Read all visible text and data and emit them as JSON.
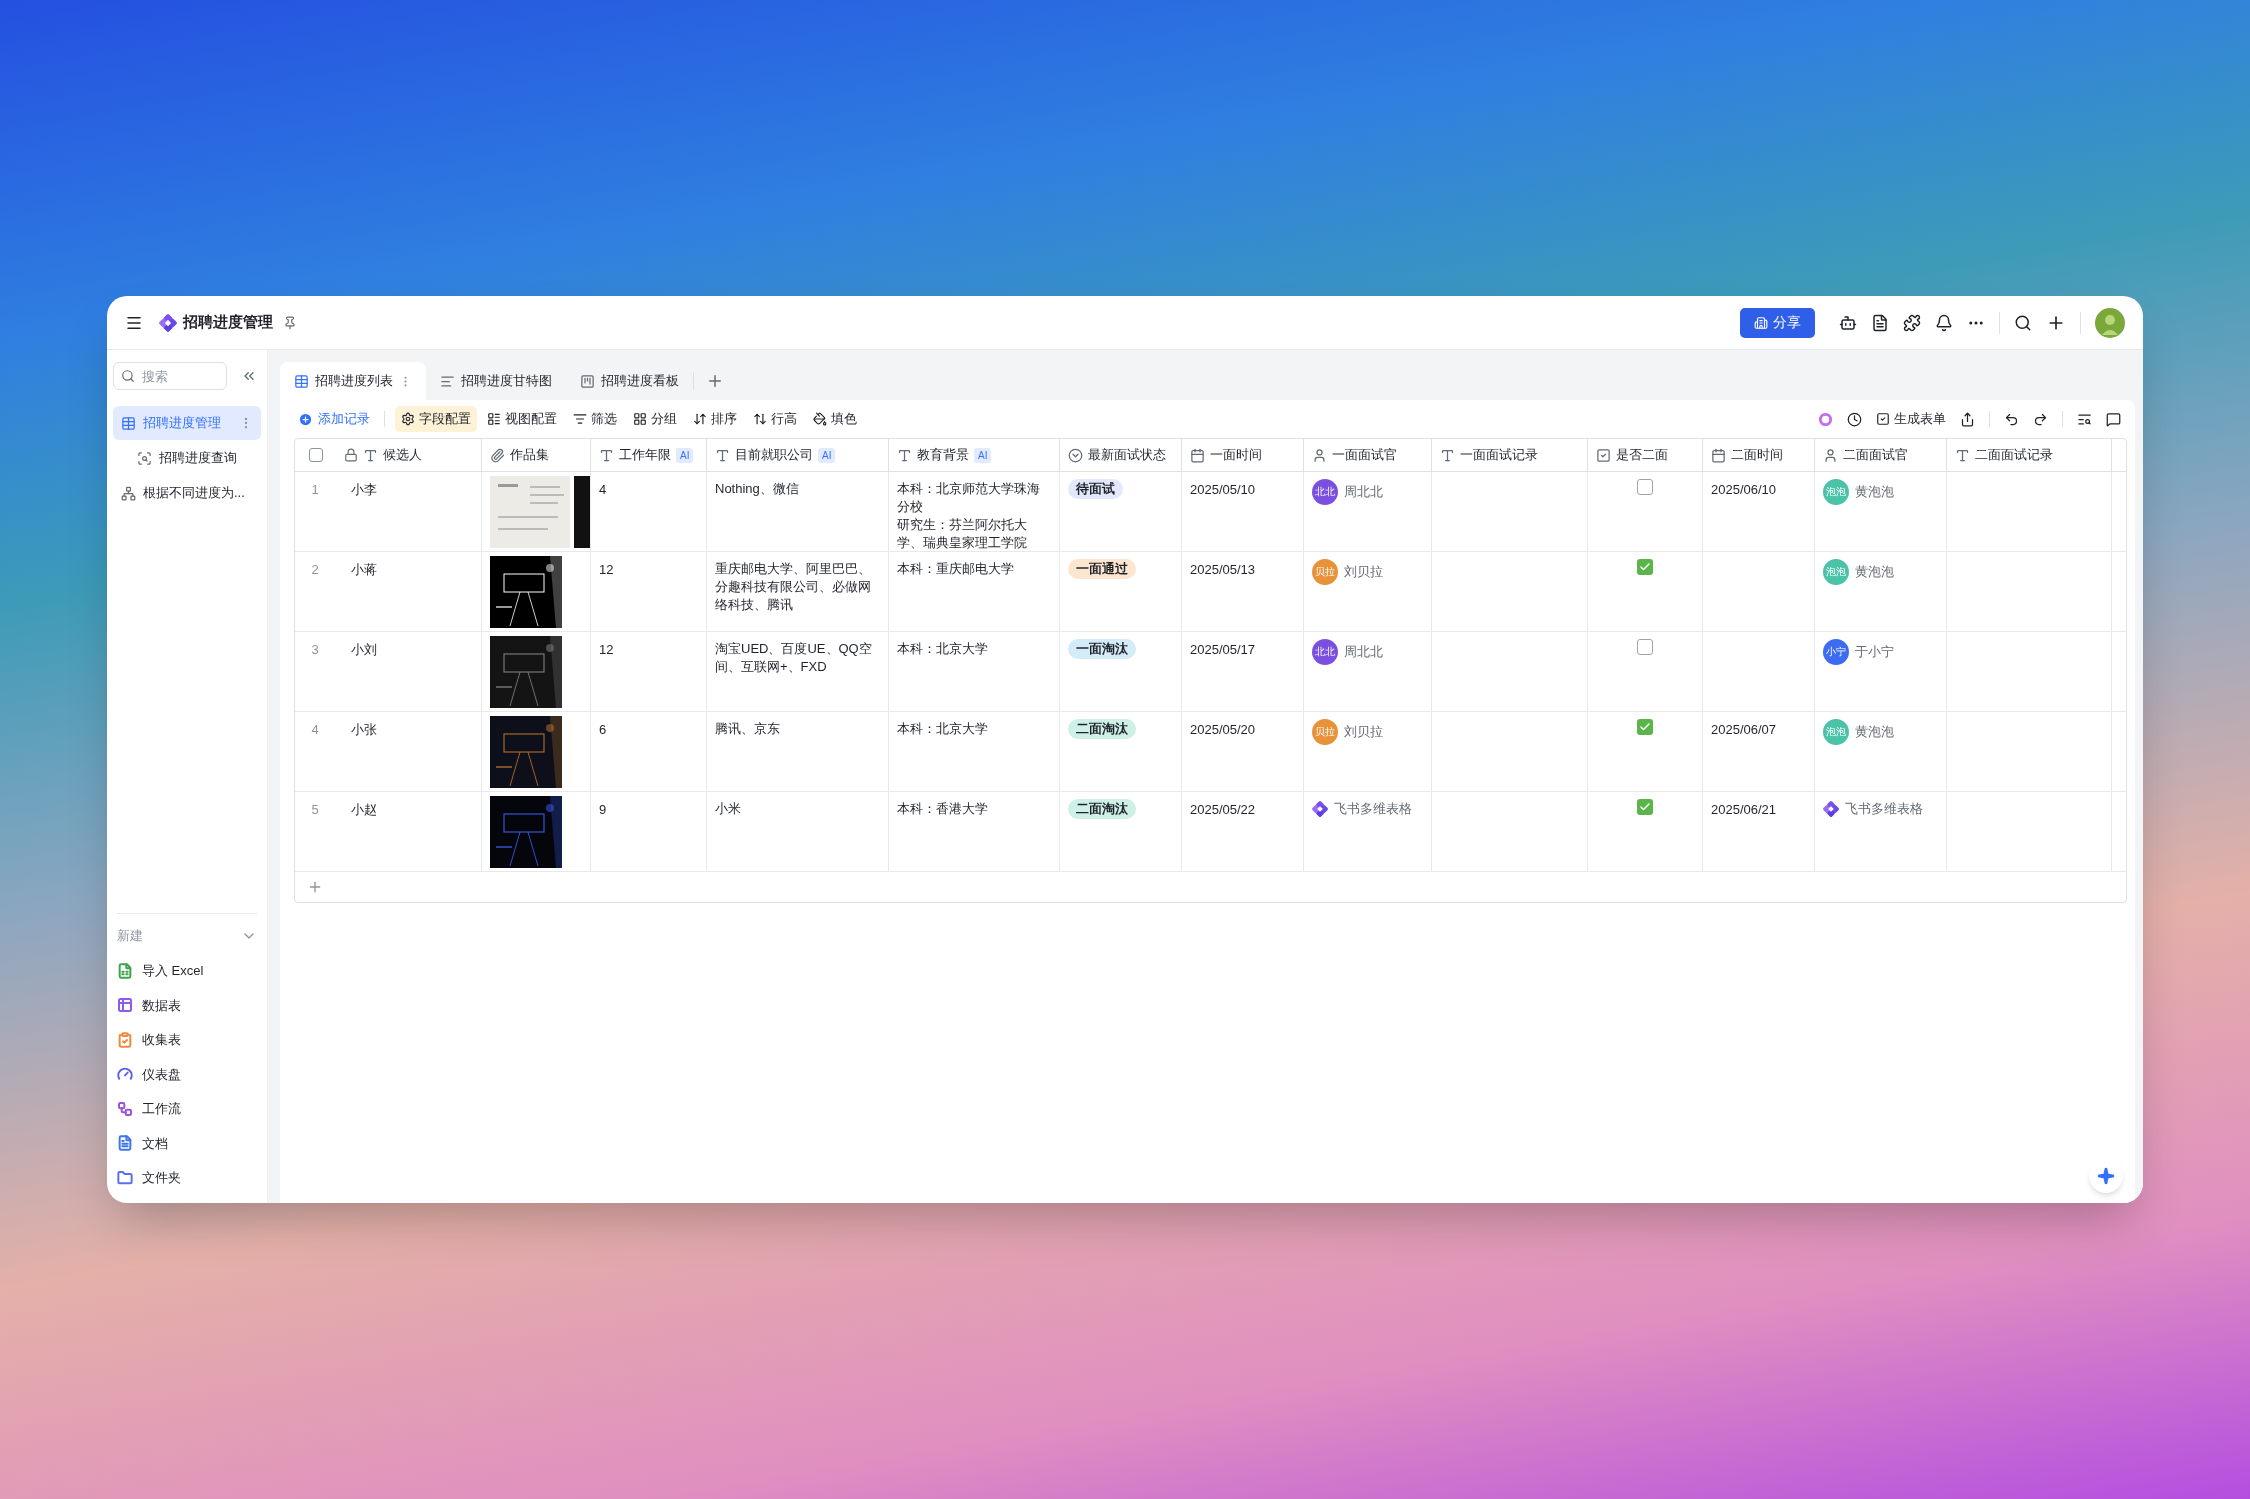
{
  "window": {
    "title": "招聘进度管理",
    "share_button": "分享"
  },
  "sidebar": {
    "search": {
      "placeholder": "搜索"
    },
    "items": [
      {
        "label": "招聘进度管理",
        "kind": "table",
        "selected": true,
        "children": [
          {
            "label": "招聘进度查询",
            "kind": "query",
            "selected": false
          }
        ]
      },
      {
        "label": "根据不同进度为...",
        "kind": "workflow",
        "selected": false
      }
    ],
    "new_section": {
      "title": "新建",
      "expanded": true,
      "items": [
        {
          "label": "导入 Excel",
          "kind": "excel",
          "color": "#3ea34a"
        },
        {
          "label": "数据表",
          "kind": "table",
          "color": "#8a5cf0"
        },
        {
          "label": "收集表",
          "kind": "form",
          "color": "#f0883e"
        },
        {
          "label": "仪表盘",
          "kind": "dashboard",
          "color": "#5a63e8"
        },
        {
          "label": "工作流",
          "kind": "workflow",
          "color": "#9b51e0"
        },
        {
          "label": "文档",
          "kind": "doc",
          "color": "#3d74f0"
        },
        {
          "label": "文件夹",
          "kind": "folder",
          "color": "#5a6ef0"
        }
      ]
    }
  },
  "tabs": [
    {
      "label": "招聘进度列表",
      "kind": "grid",
      "selected": true
    },
    {
      "label": "招聘进度甘特图",
      "kind": "gantt",
      "selected": false
    },
    {
      "label": "招聘进度看板",
      "kind": "kanban",
      "selected": false
    }
  ],
  "toolbar": {
    "add_record": "添加记录",
    "items": [
      {
        "label": "字段配置",
        "kind": "fields",
        "selected": true
      },
      {
        "label": "视图配置",
        "kind": "view",
        "selected": false
      },
      {
        "label": "筛选",
        "kind": "filter",
        "selected": false
      },
      {
        "label": "分组",
        "kind": "group",
        "selected": false
      },
      {
        "label": "排序",
        "kind": "sort",
        "selected": false
      },
      {
        "label": "行高",
        "kind": "height",
        "selected": false
      },
      {
        "label": "填色",
        "kind": "fill",
        "selected": false
      }
    ],
    "generate_form": "生成表单"
  },
  "table": {
    "columns": [
      {
        "label": "候选人",
        "kind": "text",
        "locked": true
      },
      {
        "label": "作品集",
        "kind": "attachment",
        "locked": false
      },
      {
        "label": "工作年限",
        "kind": "text",
        "locked": false,
        "badge": "AI"
      },
      {
        "label": "目前就职公司",
        "kind": "text",
        "locked": false,
        "badge": "AI"
      },
      {
        "label": "教育背景",
        "kind": "text",
        "locked": false,
        "badge": "AI"
      },
      {
        "label": "最新面试状态",
        "kind": "select",
        "locked": false
      },
      {
        "label": "一面时间",
        "kind": "date",
        "locked": false
      },
      {
        "label": "一面面试官",
        "kind": "person",
        "locked": false
      },
      {
        "label": "一面面试记录",
        "kind": "text",
        "locked": false
      },
      {
        "label": "是否二面",
        "kind": "checkbox",
        "locked": false
      },
      {
        "label": "二面时间",
        "kind": "date",
        "locked": false
      },
      {
        "label": "二面面试官",
        "kind": "person",
        "locked": false
      },
      {
        "label": "二面面试记录",
        "kind": "text",
        "locked": false
      }
    ],
    "all_selected": false,
    "rows": [
      {
        "index": "1",
        "name": "小李",
        "portfolio": {
          "kind": "picture"
        },
        "years": "4",
        "company": "Nothing、微信",
        "education": [
          "本科：北京师范大学珠海分校",
          "研究生：芬兰阿尔托大学、瑞典皇家理工学院"
        ],
        "status": {
          "label": "待面试",
          "color": "#e3e8fc"
        },
        "date1": "2025/05/10",
        "interviewer1": {
          "kind": "person",
          "avatar": "北北",
          "name": "周北北",
          "color": "#7b4fe0"
        },
        "second_round": false,
        "date2": "2025/06/10",
        "interviewer2": {
          "kind": "person",
          "avatar": "泡泡",
          "name": "黄泡泡",
          "color": "#4cc3a8"
        }
      },
      {
        "index": "2",
        "name": "小蒋",
        "portfolio": {
          "kind": "picture"
        },
        "years": "12",
        "company": "重庆邮电大学、阿里巴巴、分趣科技有限公司、必做网络科技、腾讯",
        "education": [
          "本科：重庆邮电大学"
        ],
        "status": {
          "label": "一面通过",
          "color": "#fce6cf"
        },
        "date1": "2025/05/13",
        "interviewer1": {
          "kind": "person",
          "avatar": "贝拉",
          "name": "刘贝拉",
          "color": "#e8923a"
        },
        "second_round": true,
        "interviewer2": {
          "kind": "person",
          "avatar": "泡泡",
          "name": "黄泡泡",
          "color": "#4cc3a8"
        }
      },
      {
        "index": "3",
        "name": "小刘",
        "portfolio": {
          "kind": "picture"
        },
        "years": "12",
        "company": "淘宝UED、百度UE、QQ空间、互联网+、FXD",
        "education": [
          "本科：北京大学"
        ],
        "status": {
          "label": "一面淘汰",
          "color": "#d4ecf8"
        },
        "date1": "2025/05/17",
        "interviewer1": {
          "kind": "person",
          "avatar": "北北",
          "name": "周北北",
          "color": "#7b4fe0"
        },
        "second_round": false,
        "interviewer2": {
          "kind": "person",
          "avatar": "小宁",
          "name": "于小宁",
          "color": "#3d6cf0"
        }
      },
      {
        "index": "4",
        "name": "小张",
        "portfolio": {
          "kind": "picture"
        },
        "years": "6",
        "company": "腾讯、京东",
        "education": [
          "本科：北京大学"
        ],
        "status": {
          "label": "二面淘汰",
          "color": "#cff0e6"
        },
        "date1": "2025/05/20",
        "interviewer1": {
          "kind": "person",
          "avatar": "贝拉",
          "name": "刘贝拉",
          "color": "#e8923a"
        },
        "second_round": true,
        "date2": "2025/06/07",
        "interviewer2": {
          "kind": "person",
          "avatar": "泡泡",
          "name": "黄泡泡",
          "color": "#4cc3a8"
        }
      },
      {
        "index": "5",
        "name": "小赵",
        "portfolio": {
          "kind": "picture"
        },
        "years": "9",
        "company": "小米",
        "education": [
          "本科：香港大学"
        ],
        "status": {
          "label": "二面淘汰",
          "color": "#cff0e6"
        },
        "date1": "2025/05/22",
        "interviewer1": {
          "kind": "app",
          "name": "飞书多维表格"
        },
        "second_round": true,
        "date2": "2025/06/21",
        "interviewer2": {
          "kind": "app",
          "name": "飞书多维表格"
        }
      }
    ]
  }
}
